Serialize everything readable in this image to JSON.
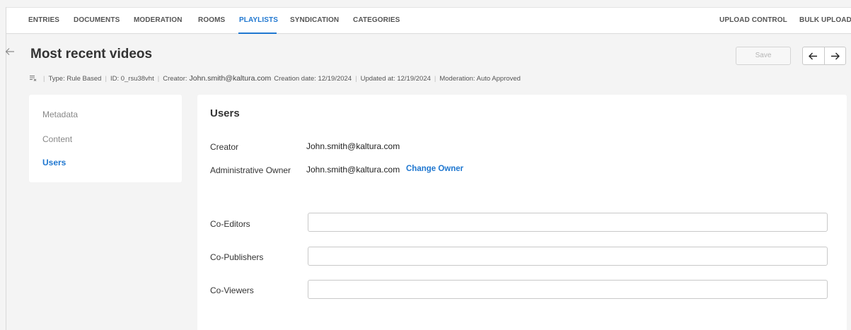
{
  "nav": {
    "tabs": [
      {
        "label": "ENTRIES"
      },
      {
        "label": "DOCUMENTS"
      },
      {
        "label": "MODERATION"
      },
      {
        "label": "ROOMS"
      },
      {
        "label": "PLAYLISTS",
        "active": true
      },
      {
        "label": "SYNDICATION"
      },
      {
        "label": "CATEGORIES"
      }
    ],
    "right_tabs": [
      {
        "label": "UPLOAD CONTROL"
      },
      {
        "label": "BULK UPLOAD"
      }
    ]
  },
  "header": {
    "title": "Most recent videos",
    "save_label": "Save",
    "prev_icon": "arrow-left-icon",
    "next_icon": "arrow-right-icon",
    "back_icon": "back-arrow-icon"
  },
  "details": {
    "icon": "rule-based-playlist-icon",
    "type": "Type: Rule Based",
    "id": "ID: 0_rsu38vht",
    "creator_label": "Creator:",
    "creator_value": "John.smith@kaltura.com",
    "creation_date": "Creation date: 12/19/2024",
    "updated_at": "Updated at: 12/19/2024",
    "moderation": "Moderation: Auto Approved"
  },
  "sidebar": {
    "items": [
      {
        "label": "Metadata"
      },
      {
        "label": "Content"
      },
      {
        "label": "Users",
        "active": true
      }
    ]
  },
  "users": {
    "title": "Users",
    "creator_label": "Creator",
    "creator_value": "John.smith@kaltura.com",
    "owner_label": "Administrative Owner",
    "owner_value": "John.smith@kaltura.com",
    "change_owner_label": "Change Owner",
    "co_editors_label": "Co-Editors",
    "co_editors_value": "",
    "co_publishers_label": "Co-Publishers",
    "co_publishers_value": "",
    "co_viewers_label": "Co-Viewers",
    "co_viewers_value": ""
  },
  "colors": {
    "accent": "#1f77d0",
    "background": "#f4f4f4",
    "panel": "#ffffff"
  }
}
